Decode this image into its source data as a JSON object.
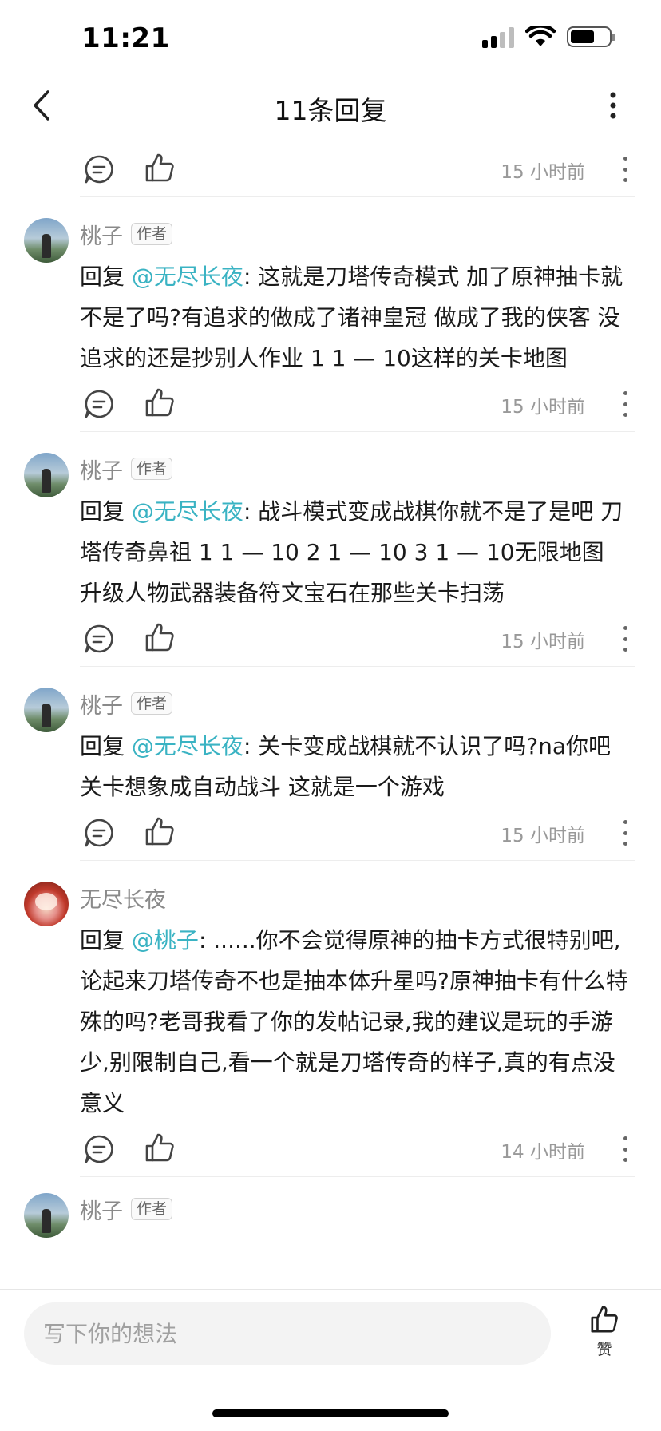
{
  "status_bar": {
    "time": "11:21"
  },
  "header": {
    "title": "11条回复"
  },
  "first_action": {
    "timestamp": "15 小时前"
  },
  "comments": [
    {
      "user": "桃子",
      "badge": "作者",
      "prefix": "回复",
      "mention": "@无尽长夜",
      "colon": ":",
      "text": "这就是刀塔传奇模式 加了原神抽卡就不是了吗?有追求的做成了诸神皇冠 做成了我的侠客 没追求的还是抄别人作业 1 1 — 10这样的关卡地图",
      "timestamp": "15 小时前"
    },
    {
      "user": "桃子",
      "badge": "作者",
      "prefix": "回复",
      "mention": "@无尽长夜",
      "colon": ":",
      "text": "战斗模式变成战棋你就不是了是吧 刀塔传奇鼻祖 1 1 — 10 2 1 — 10 3 1 — 10无限地图 升级人物武器装备符文宝石在那些关卡扫荡",
      "timestamp": "15 小时前"
    },
    {
      "user": "桃子",
      "badge": "作者",
      "prefix": "回复",
      "mention": "@无尽长夜",
      "colon": ":",
      "text": "关卡变成战棋就不认识了吗?na你吧关卡想象成自动战斗 这就是一个游戏",
      "timestamp": "15 小时前"
    },
    {
      "user": "无尽长夜",
      "badge": "",
      "prefix": "回复",
      "mention": "@桃子",
      "colon": ":",
      "text": "......你不会觉得原神的抽卡方式很特别吧,论起来刀塔传奇不也是抽本体升星吗?原神抽卡有什么特殊的吗?老哥我看了你的发帖记录,我的建议是玩的手游少,别限制自己,看一个就是刀塔传奇的样子,真的有点没意义",
      "timestamp": "14 小时前"
    }
  ],
  "peek_comment": {
    "user": "桃子",
    "badge": "作者"
  },
  "bottom_bar": {
    "placeholder": "写下你的想法",
    "like_label": "赞"
  }
}
